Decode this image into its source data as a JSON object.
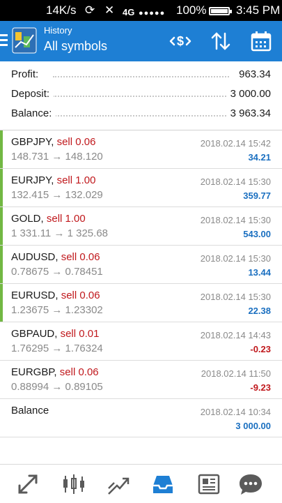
{
  "status_bar": {
    "speed": "14K/s",
    "network": "4G",
    "battery": "100%",
    "time": "3:45 PM"
  },
  "app_bar": {
    "subtitle": "History",
    "title": "All symbols",
    "icons": [
      "menu-icon",
      "app-logo-icon",
      "deposit-dollar-icon",
      "sort-icon",
      "calendar-icon"
    ],
    "accent_color": "#1e7fd4"
  },
  "summary": {
    "profit_label": "Profit:",
    "profit_value": "963.34",
    "deposit_label": "Deposit:",
    "deposit_value": "3 000.00",
    "balance_label": "Balance:",
    "balance_value": "3 963.34"
  },
  "deals": [
    {
      "symbol": "GBPJPY,",
      "action": "sell 0.06",
      "prices": "148.731 → 148.120",
      "time": "2018.02.14 15:42",
      "profit": "34.21",
      "sign": "pos",
      "bar": true
    },
    {
      "symbol": "EURJPY,",
      "action": "sell 1.00",
      "prices": "132.415 → 132.029",
      "time": "2018.02.14 15:30",
      "profit": "359.77",
      "sign": "pos",
      "bar": true
    },
    {
      "symbol": "GOLD,",
      "action": "sell 1.00",
      "prices": "1 331.11 → 1 325.68",
      "time": "2018.02.14 15:30",
      "profit": "543.00",
      "sign": "pos",
      "bar": true
    },
    {
      "symbol": "AUDUSD,",
      "action": "sell 0.06",
      "prices": "0.78675 → 0.78451",
      "time": "2018.02.14 15:30",
      "profit": "13.44",
      "sign": "pos",
      "bar": true
    },
    {
      "symbol": "EURUSD,",
      "action": "sell 0.06",
      "prices": "1.23675 → 1.23302",
      "time": "2018.02.14 15:30",
      "profit": "22.38",
      "sign": "pos",
      "bar": true
    },
    {
      "symbol": "GBPAUD,",
      "action": "sell 0.01",
      "prices": "1.76295 → 1.76324",
      "time": "2018.02.14 14:43",
      "profit": "-0.23",
      "sign": "neg",
      "bar": false
    },
    {
      "symbol": "EURGBP,",
      "action": "sell 0.06",
      "prices": "0.88994 → 0.89105",
      "time": "2018.02.14 11:50",
      "profit": "-9.23",
      "sign": "neg",
      "bar": false
    },
    {
      "symbol": "Balance",
      "action": "",
      "prices": "",
      "time": "2018.02.14 10:34",
      "profit": "3 000.00",
      "sign": "pos",
      "bar": false
    }
  ],
  "bottom_nav": {
    "items": [
      "quotes-icon",
      "chart-candles-icon",
      "trade-icon",
      "history-icon",
      "news-icon",
      "chat-icon"
    ],
    "active": "history-icon",
    "active_color": "#1e7fd4",
    "inactive_color": "#5a5a5a"
  }
}
